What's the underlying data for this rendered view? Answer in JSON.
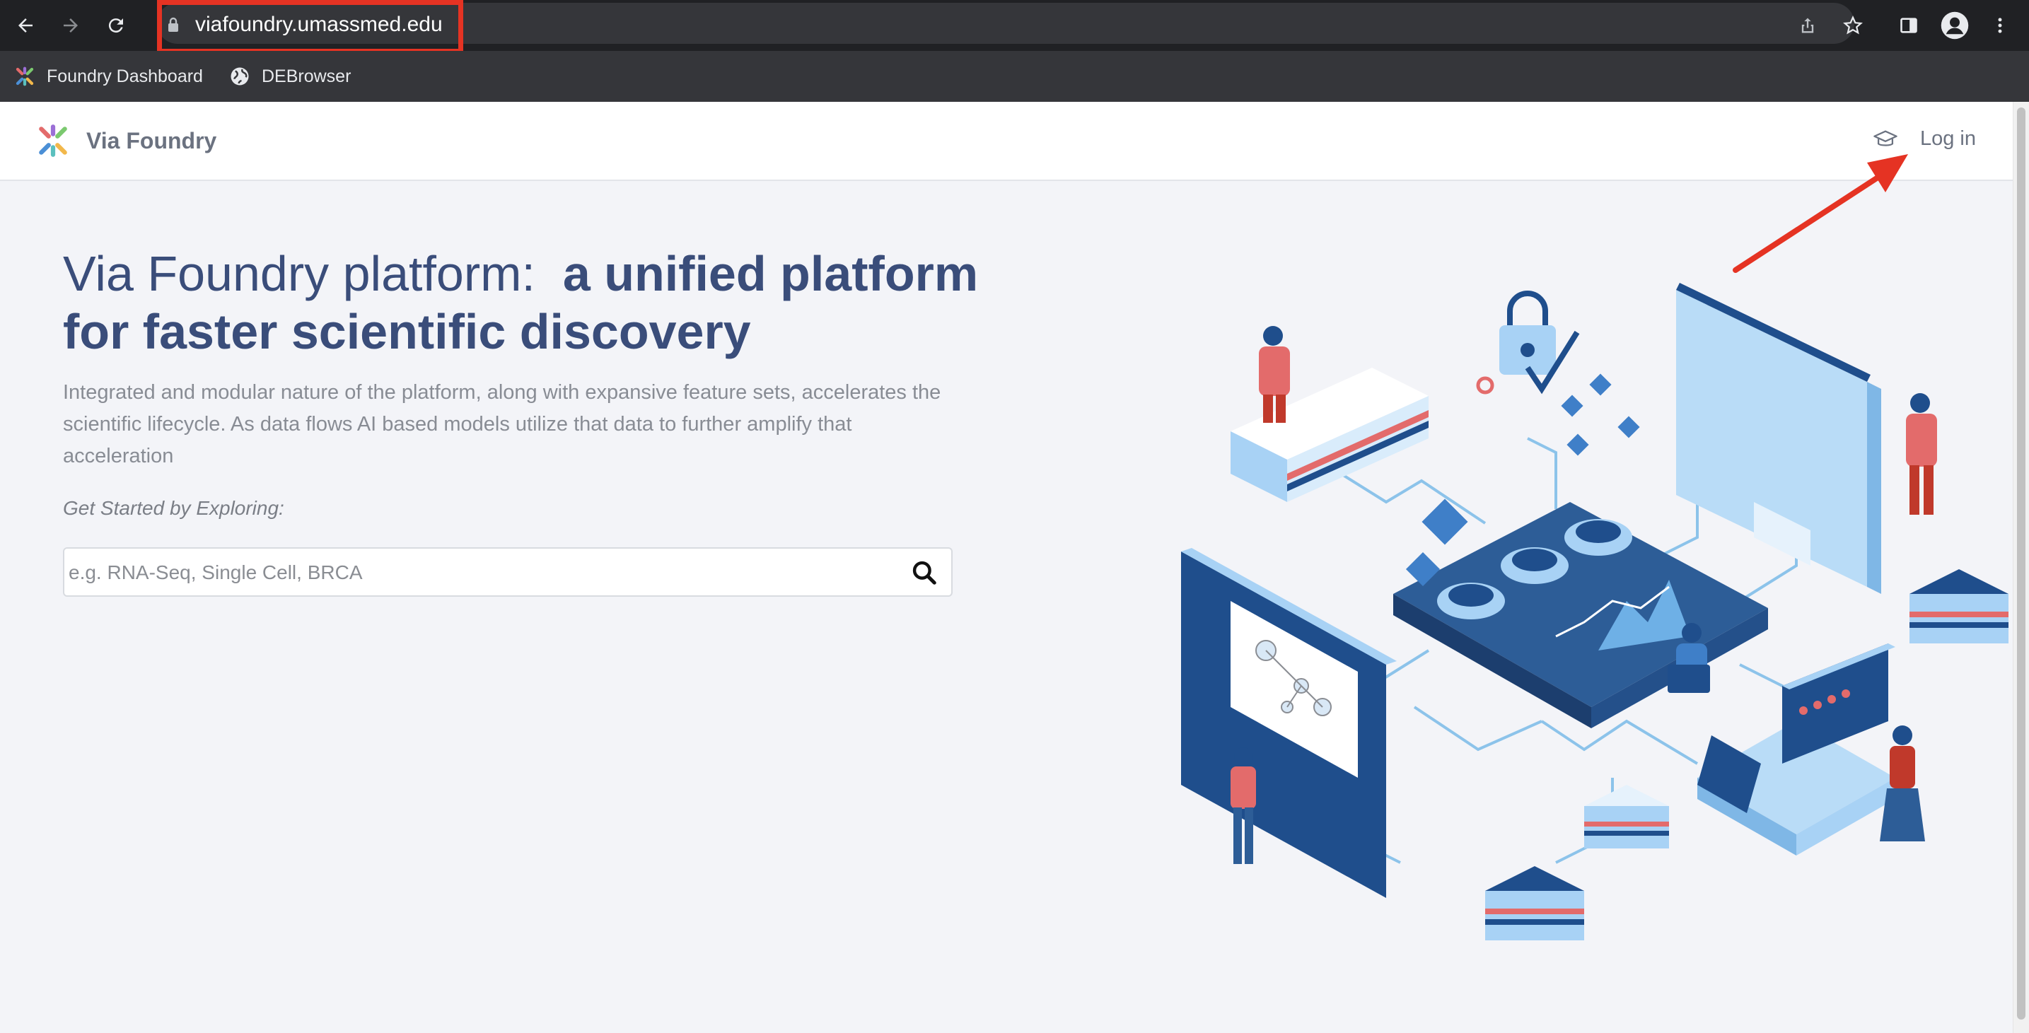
{
  "browser": {
    "url": "viafoundry.umassmed.edu",
    "nav_icons": [
      "back-arrow-icon",
      "forward-arrow-icon",
      "reload-icon"
    ],
    "toolbar_icons": [
      "share-icon",
      "star-icon",
      "side-panel-icon",
      "profile-icon",
      "menu-icon"
    ],
    "bookmarks": [
      {
        "label": "Foundry Dashboard",
        "icon": "foundry-logo-icon"
      },
      {
        "label": "DEBrowser",
        "icon": "globe-icon"
      }
    ]
  },
  "header": {
    "brand": "Via Foundry",
    "login_label": "Log in",
    "login_icon": "graduation-cap-icon"
  },
  "hero": {
    "title_regular": "Via Foundry platform:",
    "title_bold": "a unified platform for faster scientific discovery",
    "description": "Integrated and modular nature of the platform, along with expansive feature sets, accelerates the scientific lifecycle. As data flows AI based models utilize that data to further amplify that acceleration",
    "explore_label": "Get Started by Exploring:",
    "search_placeholder": "e.g. RNA-Seq, Single Cell, BRCA"
  },
  "colors": {
    "title": "#3a4d7a",
    "annotation": "#e53323",
    "illustration_dark": "#1f4e8c",
    "illustration_light": "#a8d2f5",
    "illustration_red": "#e36b6b"
  }
}
